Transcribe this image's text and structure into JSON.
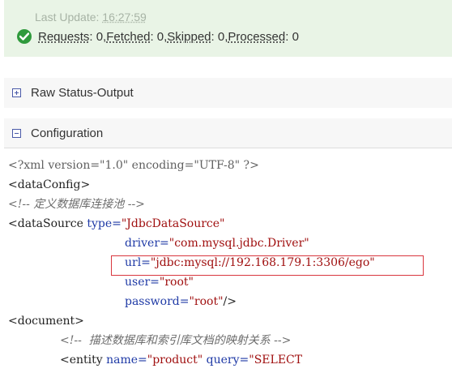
{
  "status": {
    "last_update_label": "Last Update:",
    "last_update_time": "16:27:59",
    "requests_label": "Requests",
    "requests_value": ": 0, ",
    "fetched_label": "Fetched",
    "fetched_value": ": 0, ",
    "skipped_label": "Skipped",
    "skipped_value": ": 0, ",
    "processed_label": "Processed",
    "processed_value": ": 0"
  },
  "panels": {
    "raw_status": "Raw Status-Output",
    "configuration": "Configuration"
  },
  "code": {
    "l1": "<?xml version=\"1.0\" encoding=\"UTF-8\" ?>",
    "l2": "<dataConfig>",
    "l3": "<!-- 定义数据库连接池 -->",
    "l4_tag": "<dataSource ",
    "l4_attr": "type=",
    "l4_val": "\"JdbcDataSource\"",
    "l5_attr": "driver=",
    "l5_val": "\"com.mysql.jdbc.Driver\"",
    "l6_attr": "url=",
    "l6_val": "\"jdbc:mysql://192.168.179.1:3306/ego\"",
    "l7_attr": "user=",
    "l7_val": "\"root\"",
    "l8_attr": "password=",
    "l8_val": "\"root\"",
    "l8_end": "/>",
    "l9": "<document>",
    "l10": "<!--  描述数据库和索引库文档的映射关系 -->",
    "l11_tag": "<entity ",
    "l11_attr1": "name=",
    "l11_val1": "\"product\"",
    "l11_attr2": "query=",
    "l11_val2": "\"SELECT"
  },
  "colors": {
    "status_bg": "#e9f4e6",
    "ok_green": "#2f9a3c",
    "attr_blue": "#1f3aa6",
    "value_red": "#a01010",
    "highlight_red": "#d9363e"
  }
}
